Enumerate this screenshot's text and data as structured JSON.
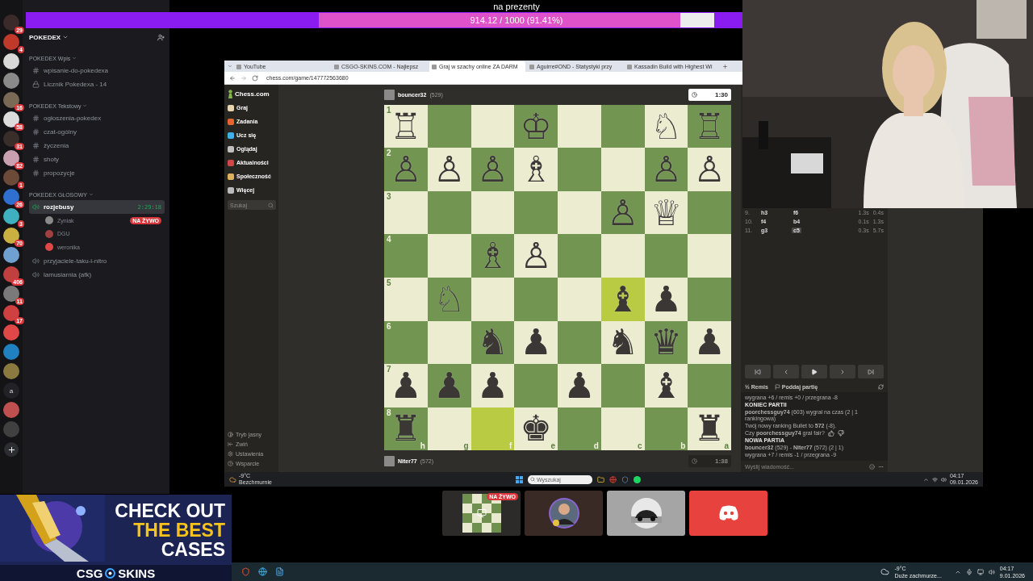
{
  "stream": {
    "goal_title": "na prezenty",
    "goal_progress": "914.12 / 1000 (91.41%)",
    "level": 0.9141
  },
  "discord": {
    "servers": [
      {
        "color": "#3b2a2a",
        "badge": "29"
      },
      {
        "color": "#c0392b",
        "badge": "4"
      },
      {
        "color": "#d9d9d9"
      },
      {
        "color": "#8a8a8a"
      },
      {
        "color": "#7a6a55",
        "badge": "16"
      },
      {
        "color": "#dcdcdc",
        "badge": "58"
      },
      {
        "color": "#3a2e2a",
        "badge": "31"
      },
      {
        "color": "#c9a0b0",
        "badge": "82"
      },
      {
        "color": "#6b4a3a",
        "badge": "1"
      },
      {
        "color": "#2f6fd0",
        "badge": "26"
      },
      {
        "color": "#3fb0c0",
        "badge": "3"
      },
      {
        "color": "#c9b040",
        "badge": "70"
      },
      {
        "color": "#6fa0d0"
      },
      {
        "color": "#c04040",
        "badge": "406"
      },
      {
        "color": "#7a7a7a",
        "badge": "11"
      },
      {
        "color": "#d04040",
        "badge": "17"
      },
      {
        "color": "#e04848"
      },
      {
        "color": "#2080c0"
      },
      {
        "color": "#8a7a40"
      },
      {
        "color": "#222226",
        "label": "a"
      },
      {
        "color": "#c05050"
      },
      {
        "color": "#404040"
      }
    ],
    "server_name": "POKEDEX",
    "categories": [
      {
        "name": "POKEDEX Wpis",
        "channels": [
          {
            "kind": "text",
            "name": "wpisanie-do-pokedexa",
            "active": false
          },
          {
            "kind": "locked",
            "name": "Licznik Pokedexa - 14",
            "active": false
          }
        ]
      },
      {
        "name": "POKEDEX Tekstowy",
        "channels": [
          {
            "kind": "text",
            "name": "ogłoszenia-pokedex",
            "active": false
          },
          {
            "kind": "text",
            "name": "czat-ogólny",
            "active": false
          },
          {
            "kind": "text",
            "name": "życzenia",
            "active": false
          },
          {
            "kind": "text",
            "name": "shoty",
            "active": false
          },
          {
            "kind": "text",
            "name": "propozycje",
            "active": false
          }
        ]
      },
      {
        "name": "POKEDEX GŁOSOWY",
        "channels": [
          {
            "kind": "voice",
            "name": "rozjebusy",
            "active": true,
            "timer": "2:29:18",
            "members": [
              {
                "name": "Zyniak",
                "badge": "NA ŻYWO"
              },
              {
                "name": "DGU"
              },
              {
                "name": "weronika"
              }
            ]
          },
          {
            "kind": "voice",
            "name": "przyjaciele-taku-i-nitro",
            "active": false
          },
          {
            "kind": "voice",
            "name": "lamusiarnia (afk)",
            "active": false
          }
        ]
      }
    ]
  },
  "browser": {
    "tabs": [
      {
        "title": "YouTube",
        "selected": false
      },
      {
        "title": "CSGO-SKINS.COM - Najlepsz",
        "selected": false
      },
      {
        "title": "Graj w szachy online ZA DARM",
        "selected": true
      },
      {
        "title": "Aguirre#OND - Statystyki przy",
        "selected": false
      },
      {
        "title": "Kassadin Build with Highest Wi",
        "selected": false
      }
    ],
    "url": "chess.com/game/147772563680"
  },
  "chess": {
    "logo": "Chess.com",
    "nav": [
      "Graj",
      "Zadania",
      "Ucz się",
      "Oglądaj",
      "Aktualności",
      "Społeczność",
      "Więcej"
    ],
    "search_placeholder": "Szukaj",
    "footer": [
      "Tryb jasny",
      "Zwiń",
      "Ustawienia",
      "Wsparcie"
    ],
    "top_player": {
      "name": "bouncer32",
      "rating": "(529)",
      "clock": "1:30",
      "active": true
    },
    "bottom_player": {
      "name": "Niter77",
      "rating": "(572)",
      "clock": "1:38",
      "active": false
    },
    "board": {
      "files": [
        "h",
        "g",
        "f",
        "e",
        "d",
        "c",
        "b",
        "a"
      ],
      "ranks": [
        {
          "label": "1",
          "squares": [
            {
              "piece": "♖",
              "highlighted": false
            },
            {
              "highlighted": false
            },
            {
              "highlighted": false
            },
            {
              "piece": "♔",
              "highlighted": false
            },
            {
              "highlighted": false
            },
            {
              "highlighted": false
            },
            {
              "piece": "♘",
              "highlighted": false
            },
            {
              "piece": "♖",
              "highlighted": false
            }
          ]
        },
        {
          "label": "2",
          "squares": [
            {
              "piece": "♙",
              "highlighted": false
            },
            {
              "piece": "♙",
              "highlighted": false
            },
            {
              "piece": "♙",
              "highlighted": false
            },
            {
              "piece": "♗",
              "highlighted": false
            },
            {
              "highlighted": false
            },
            {
              "highlighted": false
            },
            {
              "piece": "♙",
              "highlighted": false
            },
            {
              "piece": "♙",
              "highlighted": false
            }
          ]
        },
        {
          "label": "3",
          "squares": [
            {
              "highlighted": false
            },
            {
              "highlighted": false
            },
            {
              "highlighted": false
            },
            {
              "highlighted": false
            },
            {
              "highlighted": false
            },
            {
              "piece": "♙",
              "highlighted": false
            },
            {
              "piece": "♕",
              "highlighted": false
            },
            {
              "highlighted": false
            }
          ]
        },
        {
          "label": "4",
          "squares": [
            {
              "highlighted": false
            },
            {
              "highlighted": false
            },
            {
              "piece": "♗",
              "highlighted": false
            },
            {
              "piece": "♙",
              "highlighted": false
            },
            {
              "highlighted": false
            },
            {
              "highlighted": false
            },
            {
              "highlighted": false
            },
            {
              "highlighted": false
            }
          ]
        },
        {
          "label": "5",
          "squares": [
            {
              "highlighted": false
            },
            {
              "piece": "♘",
              "highlighted": false
            },
            {
              "highlighted": false
            },
            {
              "highlighted": false
            },
            {
              "highlighted": false
            },
            {
              "piece": "♝",
              "highlighted": true
            },
            {
              "piece": "♟",
              "highlighted": false
            },
            {
              "highlighted": false
            }
          ]
        },
        {
          "label": "6",
          "squares": [
            {
              "highlighted": false
            },
            {
              "highlighted": false
            },
            {
              "piece": "♞",
              "highlighted": false
            },
            {
              "piece": "♟",
              "highlighted": false
            },
            {
              "highlighted": false
            },
            {
              "piece": "♞",
              "highlighted": false
            },
            {
              "piece": "♛",
              "highlighted": false
            },
            {
              "piece": "♟",
              "highlighted": false
            }
          ]
        },
        {
          "label": "7",
          "squares": [
            {
              "piece": "♟",
              "highlighted": false
            },
            {
              "piece": "♟",
              "highlighted": false
            },
            {
              "piece": "♟",
              "highlighted": false
            },
            {
              "highlighted": false
            },
            {
              "piece": "♟",
              "highlighted": false
            },
            {
              "highlighted": false
            },
            {
              "piece": "♝",
              "highlighted": false
            },
            {
              "highlighted": false
            }
          ]
        },
        {
          "label": "8",
          "squares": [
            {
              "piece": "♜",
              "highlighted": false
            },
            {
              "highlighted": false
            },
            {
              "highlighted": true
            },
            {
              "piece": "♚",
              "highlighted": false
            },
            {
              "highlighted": false
            },
            {
              "highlighted": false
            },
            {
              "highlighted": false
            },
            {
              "piece": "♜",
              "highlighted": false
            }
          ]
        }
      ]
    },
    "moves": [
      {
        "number": "9.",
        "white": {
          "san": "h3",
          "time": "1.3s",
          "selected": false
        },
        "black": {
          "san": "f6",
          "time": "0.4s",
          "selected": false
        }
      },
      {
        "number": "10.",
        "white": {
          "san": "f4",
          "time": "0.1s",
          "selected": false
        },
        "black": {
          "san": "b4",
          "time": "1.3s",
          "selected": false
        }
      },
      {
        "number": "11.",
        "white": {
          "san": "g3",
          "time": "0.3s",
          "selected": false
        },
        "black": {
          "san": "c5",
          "time": "5.7s",
          "selected": true
        }
      }
    ],
    "actions": [
      {
        "kind": "draw",
        "icon": "½",
        "label": "Remis"
      },
      {
        "kind": "resign",
        "label": "Poddaj partię"
      }
    ],
    "chat": [
      {
        "kind": "line",
        "text": "wygrana +6 / remis +0 / przegrana -8"
      },
      {
        "kind": "heading",
        "text": "KONIEC PARTII"
      },
      {
        "kind": "line",
        "text": "**poorchessguy74** (603) wygrał na czas (2 | 1 rankingowa)"
      },
      {
        "kind": "line",
        "text": "Twój nowy ranking Bullet to **572** (-8)."
      },
      {
        "kind": "fair",
        "text": "Czy **poorchessguy74** grał fair?"
      },
      {
        "kind": "heading",
        "text": "NOWA PARTIA"
      },
      {
        "kind": "line",
        "text": "**bouncer32** (529) - **Niter77** (572) (2 | 1)"
      },
      {
        "kind": "line",
        "text": "wygrana +7 / remis -1 / przegrana -9"
      }
    ],
    "chat_placeholder": "Wyślij wiadomość..."
  },
  "inner_taskbar": {
    "temperature": "-9°C",
    "weather": "Bezchmurnie",
    "search_placeholder": "Wyszukaj",
    "time": "04:17",
    "date": "09.01.2026"
  },
  "ad": {
    "lines": [
      "CHECK OUT",
      "THE BEST",
      "CASES"
    ],
    "brand_left": "CSG",
    "brand_right": "SKINS"
  },
  "tiles": [
    {
      "kind": "screen",
      "badge": "NA ŻYWO"
    },
    {
      "kind": "avatar"
    },
    {
      "kind": "car"
    },
    {
      "kind": "logo"
    }
  ],
  "taskbar": {
    "temperature": "-9°C",
    "weather": "Duże zachmurze...",
    "time": "04:17",
    "date": "9.01.2026"
  }
}
